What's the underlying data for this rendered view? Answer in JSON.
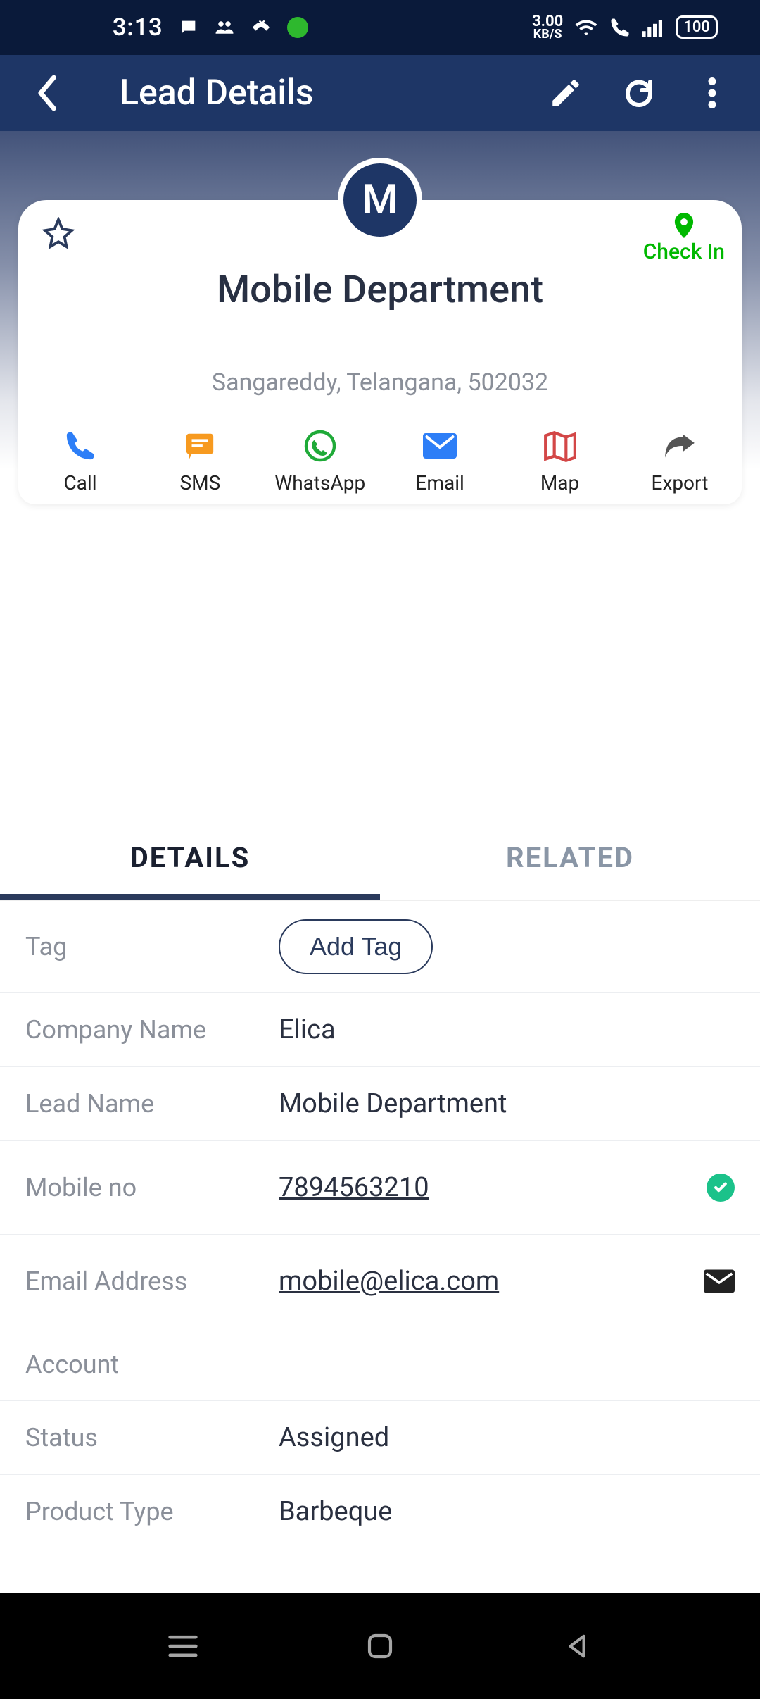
{
  "status": {
    "time": "3:13",
    "kbs_top": "3.00",
    "kbs_bottom": "KB/S",
    "battery": "100"
  },
  "appbar": {
    "title": "Lead Details"
  },
  "card": {
    "avatar_letter": "M",
    "checkin": "Check In",
    "lead_name": "Mobile Department",
    "location": "Sangareddy, Telangana, 502032",
    "actions": {
      "call": "Call",
      "sms": "SMS",
      "whatsapp": "WhatsApp",
      "email": "Email",
      "map": "Map",
      "export": "Export"
    }
  },
  "tabs": {
    "details": "DETAILS",
    "related": "RELATED"
  },
  "details": {
    "tag_label": "Tag",
    "add_tag": "Add Tag",
    "company_label": "Company Name",
    "company_value": "Elica",
    "leadname_label": "Lead Name",
    "leadname_value": "Mobile Department",
    "mobile_label": "Mobile no",
    "mobile_value": "7894563210",
    "email_label": "Email Address",
    "email_value": "mobile@elica.com",
    "account_label": "Account",
    "account_value": "",
    "status_label": "Status",
    "status_value": "Assigned",
    "product_label": "Product Type",
    "product_value": "Barbeque"
  }
}
